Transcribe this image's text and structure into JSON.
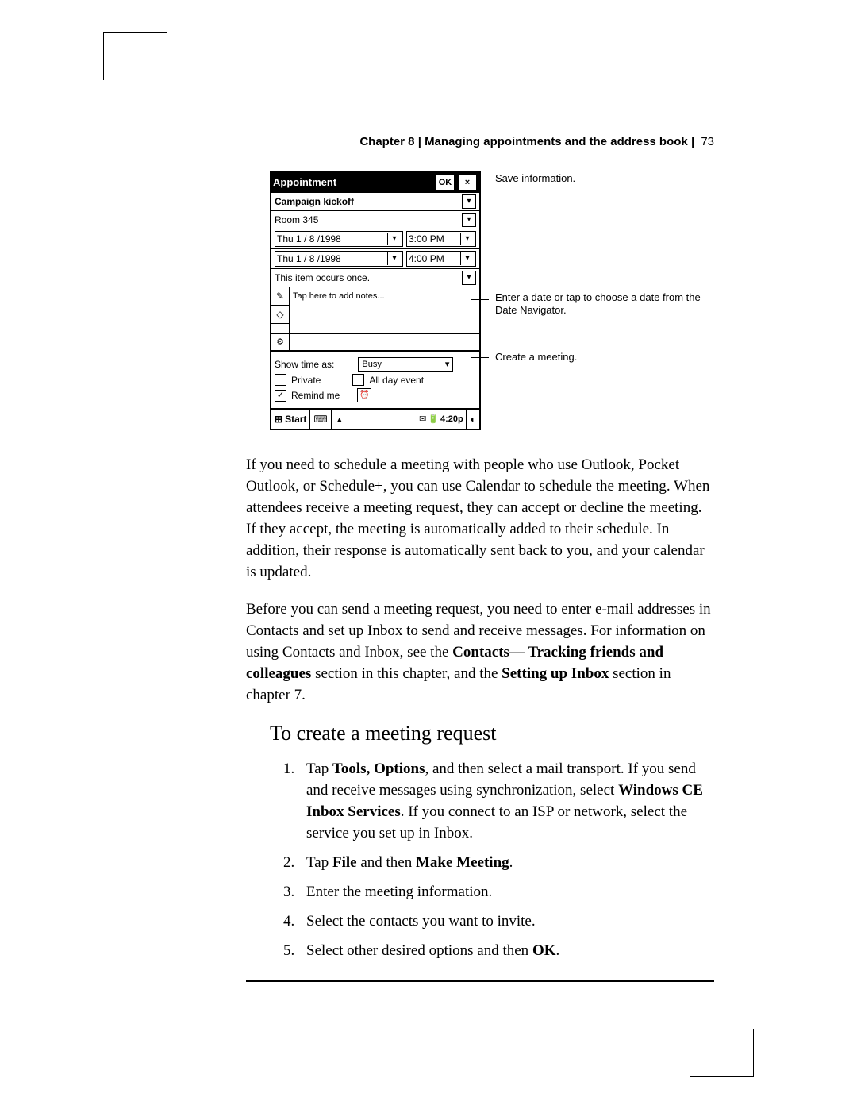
{
  "header": {
    "chapter": "Chapter 8",
    "title": "Managing appointments and the address book",
    "page": "73"
  },
  "screenshot": {
    "title": "Appointment",
    "ok_label": "OK",
    "close_label": "×",
    "subject": "Campaign kickoff",
    "location": "Room 345",
    "start_date": "Thu  1 / 8 /1998",
    "start_time": "3:00 PM",
    "end_date": "Thu  1 / 8 /1998",
    "end_time": "4:00 PM",
    "recurrence": "This item occurs once.",
    "notes_placeholder": "Tap here to add notes...",
    "tabs": {
      "notes": "✎",
      "categories": "◇",
      "meeting": "⚙"
    },
    "show_time_label": "Show time as:",
    "show_time_value": "Busy",
    "private_label": "Private",
    "all_day_label": "All day event",
    "remind_label": "Remind me",
    "remind_checked": "✓",
    "taskbar": {
      "start": "Start",
      "clock": "4:20p"
    }
  },
  "callouts": {
    "save": "Save information.",
    "date": "Enter a date or tap to choose a date from the Date Navigator.",
    "meeting": "Create a meeting."
  },
  "body": {
    "para1": "If you need to schedule a meeting with people who use Outlook, Pocket Outlook, or Schedule+, you can use Calendar to schedule the meeting. When attendees receive a meeting request, they can accept or decline the meeting. If they accept, the meeting is automatically added to their schedule. In addition, their response is automatically sent back to you, and your calendar is updated.",
    "para2a": "Before you can send a meeting request, you need to enter e-mail addresses in Contacts and set up Inbox to send and receive messages. For information on using Contacts and Inbox, see the ",
    "para2b": "Contacts— Tracking friends and colleagues",
    "para2c": " section in this chapter, and the ",
    "para2d": "Setting up Inbox",
    "para2e": " section in chapter 7.",
    "heading": "To create a meeting request",
    "steps": {
      "s1a": "Tap ",
      "s1b": "Tools, Options",
      "s1c": ", and then select a mail transport. If you send and receive messages using synchronization, select ",
      "s1d": "Windows CE Inbox Services",
      "s1e": ". If you connect to an ISP or network, select the service you set up in Inbox.",
      "s2a": "Tap ",
      "s2b": "File",
      "s2c": " and then ",
      "s2d": "Make Meeting",
      "s2e": ".",
      "s3": "Enter the meeting information.",
      "s4": "Select the contacts you want to invite.",
      "s5a": "Select other desired options and then ",
      "s5b": "OK",
      "s5c": "."
    }
  }
}
